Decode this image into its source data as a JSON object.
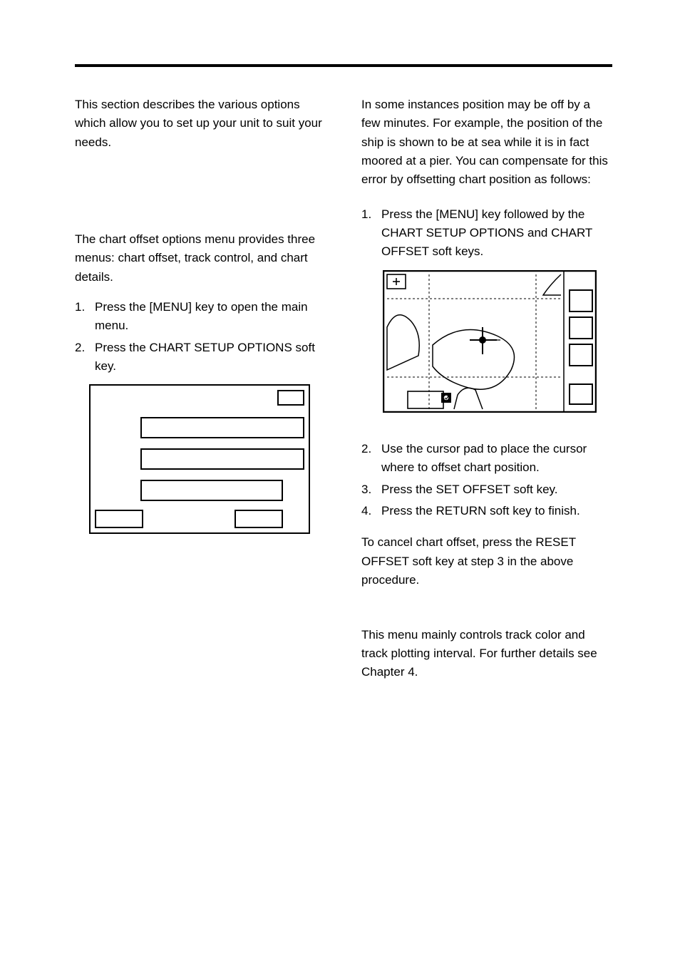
{
  "intro": "This section describes the various options which allow you to set up your unit to suit your needs.",
  "left": {
    "para": "The chart offset options menu provides three menus: chart offset, track control, and chart details.",
    "steps": [
      "Press the [MENU] key to open the main menu.",
      "Press the CHART SETUP OPTIONS soft key."
    ]
  },
  "right": {
    "intro": "In some instances position may be off by a few minutes. For example, the position of the ship is shown to be at sea while it is in fact moored at a pier. You can compensate for this error by offsetting chart position as follows:",
    "step1": "Press the [MENU] key followed by the CHART SETUP OPTIONS and CHART OFFSET soft keys.",
    "steps_after": [
      "Use the cursor pad to place the cursor where to offset chart position.",
      "Press the SET OFFSET soft key.",
      "Press the RETURN soft key to finish."
    ],
    "cancel": "To cancel chart offset, press the RESET OFFSET soft key at step 3 in the above procedure.",
    "track_menu": "This menu mainly controls track color and track plotting interval. For further details see Chapter 4."
  }
}
